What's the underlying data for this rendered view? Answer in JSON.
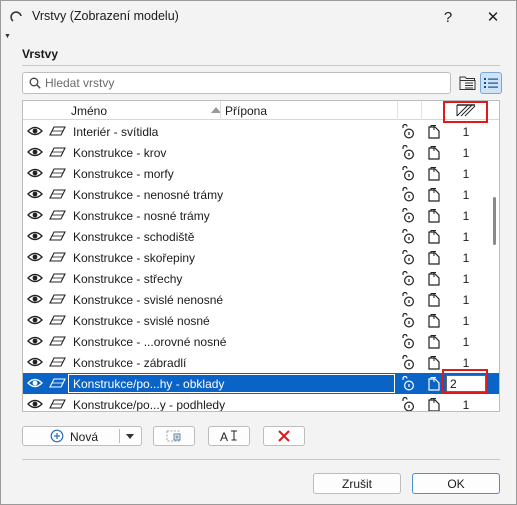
{
  "window": {
    "title": "Vrstvy (Zobrazení modelu)",
    "help_label": "?",
    "close_label": "✕"
  },
  "section": {
    "title": "Vrstvy"
  },
  "search": {
    "placeholder": "Hledat vrstvy",
    "value": ""
  },
  "table": {
    "columns": {
      "name": "Jméno",
      "extension": "Přípona"
    },
    "rows": [
      {
        "name": "Interiér - svítidla",
        "value": "1",
        "selected": false
      },
      {
        "name": "Konstrukce - krov",
        "value": "1",
        "selected": false
      },
      {
        "name": "Konstrukce - morfy",
        "value": "1",
        "selected": false
      },
      {
        "name": "Konstrukce - nenosné trámy",
        "value": "1",
        "selected": false
      },
      {
        "name": "Konstrukce - nosné trámy",
        "value": "1",
        "selected": false
      },
      {
        "name": "Konstrukce - schodiště",
        "value": "1",
        "selected": false
      },
      {
        "name": "Konstrukce - skořepiny",
        "value": "1",
        "selected": false
      },
      {
        "name": "Konstrukce - střechy",
        "value": "1",
        "selected": false
      },
      {
        "name": "Konstrukce - svislé nenosné",
        "value": "1",
        "selected": false
      },
      {
        "name": "Konstrukce - svislé nosné",
        "value": "1",
        "selected": false
      },
      {
        "name": "Konstrukce - ...orovné nosné",
        "value": "1",
        "selected": false
      },
      {
        "name": "Konstrukce - zábradlí",
        "value": "1",
        "selected": false
      },
      {
        "name": "Konstrukce/po...hy - obklady",
        "value": "2",
        "selected": true
      },
      {
        "name": "Konstrukce/po...y - podhledy",
        "value": "1",
        "selected": false
      }
    ]
  },
  "actions": {
    "new_label": "Nová"
  },
  "footer": {
    "cancel_label": "Zrušit",
    "ok_label": "OK"
  },
  "colors": {
    "selection": "#0a64c8",
    "highlight_box": "#e0191a",
    "delete_icon": "#e0191a"
  }
}
